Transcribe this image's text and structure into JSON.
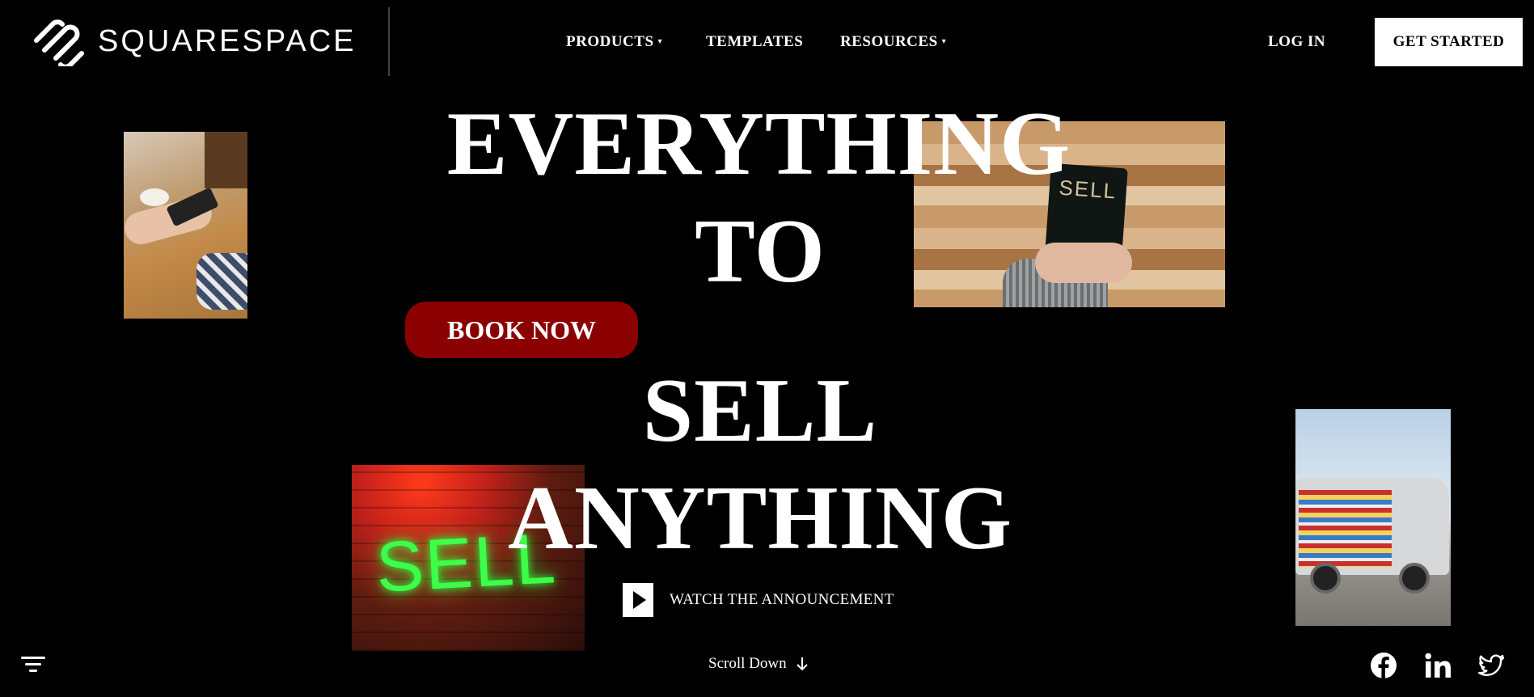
{
  "header": {
    "brand": "SQUARESPACE",
    "nav": [
      {
        "label": "PRODUCTS",
        "has_dropdown": true
      },
      {
        "label": "TEMPLATES",
        "has_dropdown": false
      },
      {
        "label": "RESOURCES",
        "has_dropdown": true
      }
    ],
    "login_label": "LOG IN",
    "cta_label": "GET STARTED"
  },
  "hero": {
    "lines": [
      "EVERYTHING",
      "TO",
      "SELL",
      "ANYTHING"
    ],
    "book_now_label": "BOOK NOW",
    "watch_label": "WATCH THE ANNOUNCEMENT",
    "accent_color": "#8b0000"
  },
  "images": {
    "sign_text": "SELL",
    "neon_text": "SELL"
  },
  "footer": {
    "scroll_label": "Scroll Down",
    "social": [
      "facebook-icon",
      "linkedin-icon",
      "twitter-icon"
    ]
  }
}
